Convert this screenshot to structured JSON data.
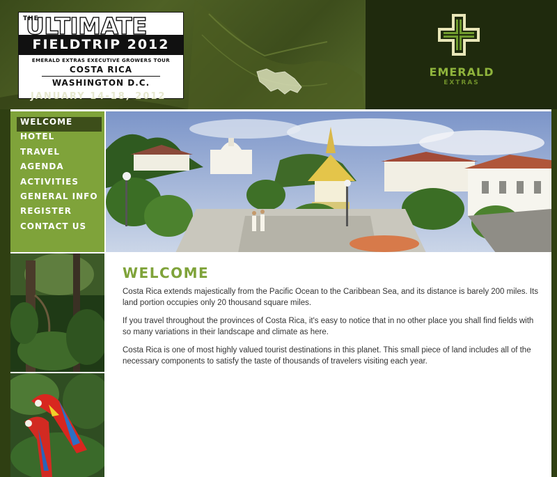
{
  "header": {
    "title_the": "THE",
    "title_main": "ULTIMATE",
    "title_sub": "FIELDTRIP 2012",
    "tour": "EMERALD EXTRAS EXECUTIVE GROWERS TOUR",
    "location1": "COSTA RICA",
    "location2": "WASHINGTON D.C.",
    "dates": "JANUARY 14-18, 2012"
  },
  "brand": {
    "name": "EMERALD",
    "sub": "EXTRAS",
    "icon": "cross-logo-icon",
    "colors": {
      "green": "#8fb43c",
      "dark": "#1f2a0d"
    }
  },
  "nav": {
    "items": [
      {
        "label": "WELCOME",
        "active": true
      },
      {
        "label": "HOTEL"
      },
      {
        "label": "TRAVEL"
      },
      {
        "label": "AGENDA"
      },
      {
        "label": "ACTIVITIES"
      },
      {
        "label": "GENERAL INFO"
      },
      {
        "label": "REGISTER"
      },
      {
        "label": "CONTACT US"
      }
    ],
    "colors": {
      "bg": "#7fa33a",
      "active": "#3d4e1a"
    }
  },
  "main": {
    "heading": "WELCOME",
    "paragraphs": [
      "Costa Rica extends majestically from the Pacific Ocean to the Caribbean Sea, and its distance is barely 200 miles. Its land portion occupies only 20 thousand square miles.",
      "If you travel throughout the provinces of Costa Rica, it's easy to notice that in no other place you shall find fields with so many variations in their landscape and climate as here.",
      "Costa Rica is one of most highly valued tourist destinations in this planet. This small piece of land includes all of the necessary components to satisfy the taste of thousands of travelers visiting each year."
    ]
  }
}
